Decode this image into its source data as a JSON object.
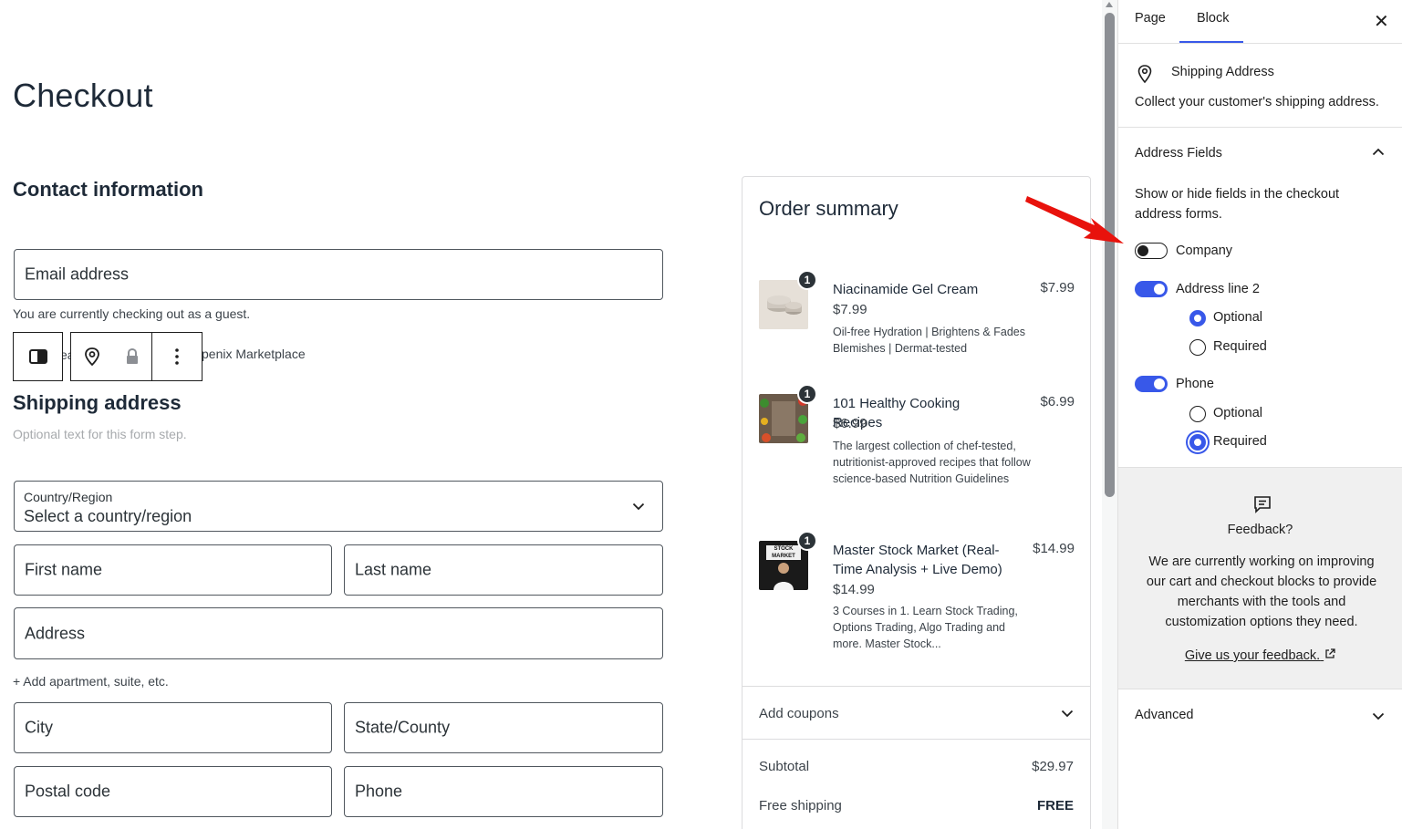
{
  "checkout": {
    "page_title": "Checkout",
    "contact_title": "Contact information",
    "email_label": "Email address",
    "guest_note": "You are currently checking out as a guest.",
    "partial_left": "ea",
    "partial_right": "penix Marketplace",
    "shipping_title": "Shipping address",
    "shipping_optional": "Optional text for this form step.",
    "country_label": "Country/Region",
    "country_value": "Select a country/region",
    "first_name": "First name",
    "last_name": "Last name",
    "address": "Address",
    "add_apartment": "+ Add apartment, suite, etc.",
    "city": "City",
    "state": "State/County",
    "postal": "Postal code",
    "phone": "Phone"
  },
  "summary": {
    "title": "Order summary",
    "items": [
      {
        "qty": "1",
        "name": "Niacinamide Gel Cream",
        "price": "$7.99",
        "unit_price": "$7.99",
        "desc": "Oil-free Hydration | Brightens & Fades Blemishes | Dermat-tested"
      },
      {
        "qty": "1",
        "name": "101 Healthy Cooking Recipes",
        "price": "$6.99",
        "unit_price": "$6.99",
        "desc": "The largest collection of chef-tested, nutritionist-approved recipes that follow science-based Nutrition Guidelines"
      },
      {
        "qty": "1",
        "name": "Master Stock Market (Real-Time Analysis + Live Demo)",
        "price": "$14.99",
        "unit_price": "$14.99",
        "desc": "3 Courses in 1. Learn Stock Trading, Options Trading, Algo Trading and more. Master Stock...",
        "thumb_text": "STOCK MARKET"
      }
    ],
    "add_coupons": "Add coupons",
    "subtotal_label": "Subtotal",
    "subtotal_value": "$29.97",
    "shipping_label": "Free shipping",
    "shipping_value": "FREE"
  },
  "sidebar": {
    "tab_page": "Page",
    "tab_block": "Block",
    "close": "✕",
    "block_title": "Shipping Address",
    "block_desc": "Collect your customer's shipping address.",
    "address_fields_title": "Address Fields",
    "address_fields_desc": "Show or hide fields in the checkout address forms.",
    "company": "Company",
    "address_line2": "Address line 2",
    "line2_optional": "Optional",
    "line2_required": "Required",
    "phone": "Phone",
    "phone_optional": "Optional",
    "phone_required": "Required",
    "feedback_title": "Feedback?",
    "feedback_body": "We are currently working on improving our cart and checkout blocks to provide merchants with the tools and customization options they need.",
    "feedback_link": "Give us your feedback.",
    "advanced": "Advanced"
  },
  "colors": {
    "accent": "#3858e9",
    "annotation_arrow": "#e8120c"
  }
}
